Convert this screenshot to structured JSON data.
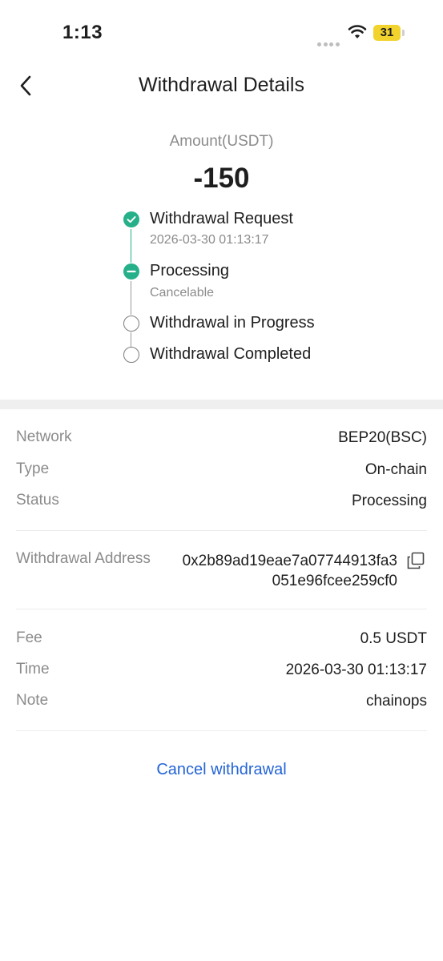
{
  "status_bar": {
    "time": "1:13",
    "battery": "31"
  },
  "header": {
    "title": "Withdrawal Details"
  },
  "amount": {
    "label": "Amount(USDT)",
    "value": "-150"
  },
  "timeline": {
    "steps": [
      {
        "title": "Withdrawal Request",
        "subtitle": "2026-03-30 01:13:17",
        "state": "done"
      },
      {
        "title": "Processing",
        "subtitle": "Cancelable",
        "state": "current"
      },
      {
        "title": "Withdrawal in Progress",
        "subtitle": "",
        "state": "pending"
      },
      {
        "title": "Withdrawal Completed",
        "subtitle": "",
        "state": "pending"
      }
    ]
  },
  "details": {
    "network": {
      "label": "Network",
      "value": "BEP20(BSC)"
    },
    "type": {
      "label": "Type",
      "value": "On-chain"
    },
    "status": {
      "label": "Status",
      "value": "Processing"
    },
    "address": {
      "label": "Withdrawal Address",
      "value": "0x2b89ad19eae7a07744913fa3051e96fcee259cf0"
    },
    "fee": {
      "label": "Fee",
      "value": "0.5 USDT"
    },
    "time": {
      "label": "Time",
      "value": "2026-03-30 01:13:17"
    },
    "note": {
      "label": "Note",
      "value": "chainops"
    }
  },
  "actions": {
    "cancel_label": "Cancel withdrawal"
  },
  "colors": {
    "accent_green": "#26b089",
    "link_blue": "#2464d6",
    "muted_text": "#8b8b8b"
  },
  "icons": [
    "back-arrow-icon",
    "wifi-icon",
    "battery-icon",
    "check-icon",
    "minus-icon",
    "copy-icon"
  ]
}
